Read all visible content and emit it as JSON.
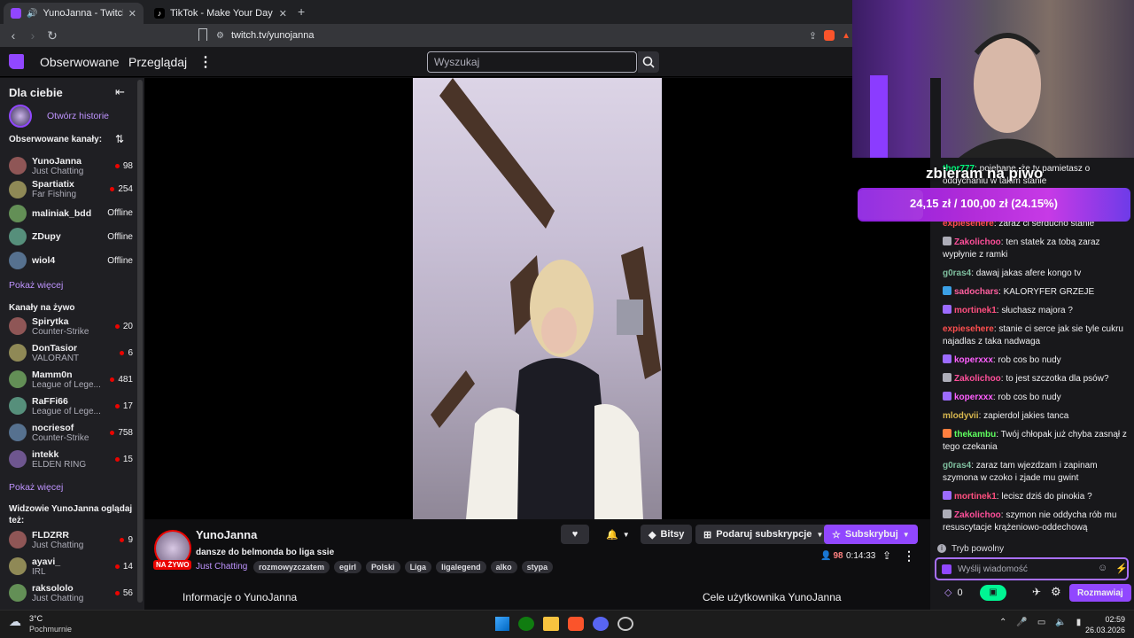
{
  "browser": {
    "tabs": [
      {
        "label": "YunoJanna - Twitch",
        "active": true,
        "color": "#9146ff"
      },
      {
        "label": "TikTok - Make Your Day",
        "active": false,
        "color": "#ffffff"
      }
    ],
    "url": "twitch.tv/yunojanna"
  },
  "topnav": {
    "followed": "Obserwowane",
    "browse": "Przeglądaj",
    "search_placeholder": "Wyszukaj"
  },
  "sidebar": {
    "title": "Dla ciebie",
    "history": "Otwórz historie",
    "followed_header": "Obserwowane kanały:",
    "followed": [
      {
        "name": "YunoJanna",
        "game": "Just Chatting",
        "count": "98",
        "live": true
      },
      {
        "name": "Spartiatix",
        "game": "Far Fishing",
        "count": "254",
        "live": true
      },
      {
        "name": "maliniak_bdd",
        "game": "",
        "count": "Offline",
        "live": false
      },
      {
        "name": "ZDupy",
        "game": "",
        "count": "Offline",
        "live": false
      },
      {
        "name": "wiol4",
        "game": "",
        "count": "Offline",
        "live": false
      }
    ],
    "show_more_1": "Pokaż więcej",
    "live_header": "Kanały na żywo",
    "live": [
      {
        "name": "Spirytka",
        "game": "Counter-Strike",
        "count": "20"
      },
      {
        "name": "DonTasior",
        "game": "VALORANT",
        "count": "6"
      },
      {
        "name": "Mamm0n",
        "game": "League of Lege...",
        "count": "481"
      },
      {
        "name": "RaFFi66",
        "game": "League of Lege...",
        "count": "17"
      },
      {
        "name": "nocriesof",
        "game": "Counter-Strike",
        "count": "758"
      },
      {
        "name": "intekk",
        "game": "ELDEN RING",
        "count": "15"
      }
    ],
    "show_more_2": "Pokaż więcej",
    "viewers_header_1": "Widzowie YunoJanna oglądaj",
    "viewers_header_2": "też:",
    "viewers": [
      {
        "name": "FLDZRR",
        "game": "Just Chatting",
        "count": "9"
      },
      {
        "name": "ayavi_",
        "game": "IRL",
        "count": "14"
      },
      {
        "name": "raksololo",
        "game": "Just Chatting",
        "count": "56"
      }
    ]
  },
  "stream": {
    "channel": "YunoJanna",
    "live_badge": "NA ŻYWO",
    "title": "dansze do belmonda bo liga ssie",
    "category": "Just Chatting",
    "tags": [
      "rozmowyzczatem",
      "egirl",
      "Polski",
      "Liga",
      "ligalegend",
      "alko",
      "stypa"
    ],
    "bits": "Bitsy",
    "gift": "Podaruj subskrypcje",
    "subscribe": "Subskrybuj",
    "viewers": "98",
    "uptime": "0:14:33",
    "about": "Informacje o YunoJanna",
    "goals": "Cele użytkownika YunoJanna"
  },
  "overlay": {
    "title": "zbieram na piwo",
    "progress": "24,15 zł / 100,00 zł (24.15%)",
    "percent": 24.15
  },
  "chat": {
    "messages": [
      {
        "user": "thor777",
        "color": "#00ff7f",
        "badge": "",
        "text": ": pojebane, że ty pamietasz o oddychaniu w takim stanie"
      },
      {
        "user": "expiesehere",
        "color": "#ff4f4f",
        "badge": "",
        "text": ": zaraz ci serducho stanie"
      },
      {
        "user": "Zakolichoo",
        "color": "#ff4f9a",
        "badge": "speaker",
        "text": ": ten statek za tobą zaraz wypłynie z ramki"
      },
      {
        "user": "g0ras4",
        "color": "#7fbf9f",
        "badge": "",
        "text": ": dawaj jakas afere kongo tv"
      },
      {
        "user": "sadochars",
        "color": "#ff5f9f",
        "badge": "blue",
        "text": ": KALORYFER GRZEJE"
      },
      {
        "user": "mortinek1",
        "color": "#ff4f7f",
        "badge": "purple",
        "text": ": słuchasz majora ?"
      },
      {
        "user": "expiesehere",
        "color": "#ff4f4f",
        "badge": "",
        "text": ": stanie ci serce jak sie tyle cukru najadlas z taka nadwaga"
      },
      {
        "user": "koperxxx",
        "color": "#ff5fff",
        "badge": "purple",
        "text": ": rob cos bo nudy"
      },
      {
        "user": "Zakolichoo",
        "color": "#ff4f9a",
        "badge": "speaker",
        "text": ": to jest szczotka dla psów?"
      },
      {
        "user": "koperxxx",
        "color": "#ff5fff",
        "badge": "purple",
        "text": ": rob cos bo nudy"
      },
      {
        "user": "mlodyvii",
        "color": "#d9b84f",
        "badge": "",
        "text": ": zapierdol jakies tanca"
      },
      {
        "user": "thekambu",
        "color": "#5fff5f",
        "badge": "orange",
        "text": ": Twój chłopak już chyba zasnął z tego czekania"
      },
      {
        "user": "g0ras4",
        "color": "#7fbf9f",
        "badge": "",
        "text": ": zaraz tam wjezdzam i zapinam szymona w czoko i zjade mu gwint"
      },
      {
        "user": "mortinek1",
        "color": "#ff4f7f",
        "badge": "purple",
        "text": ": lecisz dziś do pinokia ?"
      },
      {
        "user": "Zakolichoo",
        "color": "#ff4f9a",
        "badge": "speaker",
        "text": ": szymon nie oddycha rób mu resuscytacje krążeniowo-oddechową"
      }
    ],
    "slow_mode": "Tryb powolny",
    "input_placeholder": "Wyślij wiadomość",
    "points": "0",
    "send": "Rozmawiaj"
  },
  "taskbar": {
    "temp": "3°C",
    "weather": "Pochmurnie",
    "time": "02:59",
    "date": "26.03.2026"
  },
  "colors": {
    "accent": "#9147ff",
    "live": "#eb0400",
    "link": "#bf94ff"
  }
}
